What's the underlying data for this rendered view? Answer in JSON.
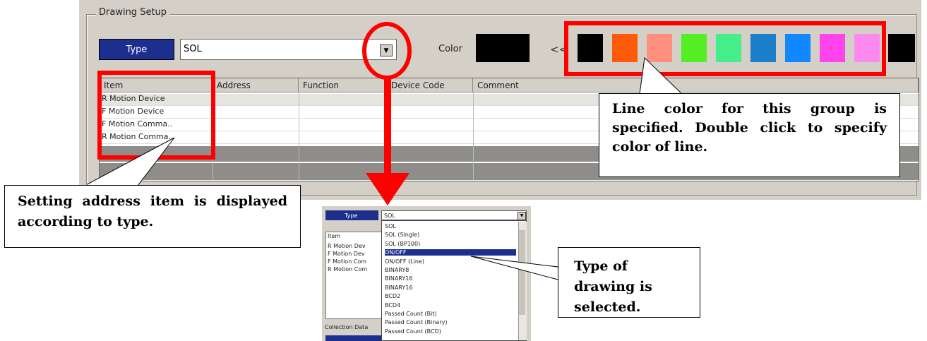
{
  "group": {
    "title": "Drawing Setup"
  },
  "type_row": {
    "type_label": "Type",
    "type_value": "SOL",
    "color_label": "Color",
    "prev_symbol": "<<"
  },
  "colors": {
    "current": "#000000",
    "palette": [
      "#000000",
      "#ff5a0a",
      "#ff9080",
      "#55ee22",
      "#44ee88",
      "#1a7ec8",
      "#1188ff",
      "#ff44ee",
      "#ff88ee"
    ],
    "extra": "#000000",
    "highlight": "#ff0000",
    "type_button": "#1c2f8e"
  },
  "table": {
    "headers": [
      "Item",
      "Address",
      "Function",
      "Device Code",
      "Comment"
    ],
    "items": [
      "R Motion Device",
      "F Motion Device",
      "F Motion Comma..",
      "R Motion Comma.."
    ]
  },
  "callouts": {
    "color": "Line color for this group is specified. Double click to specify color of line.",
    "address": "Setting address item is displayed according to type.",
    "type": "Type of drawing is selected."
  },
  "dropdown": {
    "type_label": "Type",
    "selected": "SOL",
    "options": [
      "SOL",
      "SOL (Single)",
      "SOL (BP100)",
      "ON/OFF",
      "ON/OFF (Line)",
      "BINARY8",
      "BINARY16",
      "BINARY16",
      "BCD2",
      "BCD4",
      "Passed Count (Bit)",
      "Passed Count (Binary)",
      "Passed Count (BCD)"
    ],
    "highlighted_index": 3,
    "items": [
      "Item",
      "R Motion Dev",
      "F Motion Dev",
      "F Motion Com",
      "R Motion Com"
    ],
    "footer": "Collection Data"
  }
}
